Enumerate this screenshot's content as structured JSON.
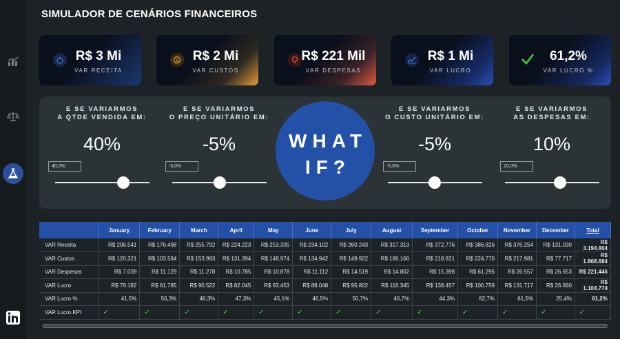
{
  "title": "SIMULADOR DE CENÁRIOS FINANCEIROS",
  "sidebar": {
    "icons": [
      "chart-icon",
      "scale-icon",
      "flask-icon",
      "linkedin-icon"
    ]
  },
  "kpis": [
    {
      "value": "R$ 3 Mi",
      "label": "VAR RECEITA",
      "icon": "money-bag-icon"
    },
    {
      "value": "R$ 2 Mi",
      "label": "VAR CUSTOS",
      "icon": "coin-icon"
    },
    {
      "value": "R$ 221 Mil",
      "label": "VAR DESPESAS",
      "icon": "expense-icon"
    },
    {
      "value": "R$ 1 Mi",
      "label": "VAR LUCRO",
      "icon": "profit-chart-icon"
    },
    {
      "value": "61,2%",
      "label": "VAR LUCRO %",
      "icon": "check-icon"
    }
  ],
  "scenarios": [
    {
      "q1": "E SE VARIARMOS",
      "q2": "A QTDE VENDIDA EM:",
      "value": "40%",
      "input": "40,0%",
      "level": 0.7
    },
    {
      "q1": "E SE VARIARMOS",
      "q2": "O PREÇO UNITÁRIO EM:",
      "value": "-5%",
      "input": "-5,0%",
      "level": 0.45
    },
    {
      "q1": "E SE VARIARMOS",
      "q2": "O CUSTO UNITÁRIO EM:",
      "value": "-5%",
      "input": "-5,0%",
      "level": 0.45
    },
    {
      "q1": "E SE VARIARMOS",
      "q2": "AS DESPESAS EM:",
      "value": "10%",
      "input": "10,0%",
      "level": 0.55
    }
  ],
  "whatif": {
    "line1": "WHAT",
    "line2": "IF?"
  },
  "table": {
    "headers": [
      "",
      "January",
      "February",
      "March",
      "April",
      "May",
      "June",
      "July",
      "August",
      "September",
      "October",
      "November",
      "December",
      "Total"
    ],
    "rows": [
      [
        "VAR Receita",
        "R$ 206.541",
        "R$ 176.498",
        "R$ 255.792",
        "R$ 224.223",
        "R$ 253.305",
        "R$ 234.102",
        "R$ 260.243",
        "R$ 317.313",
        "R$ 372.776",
        "R$ 386.826",
        "R$ 376.254",
        "R$ 131.030",
        "R$ 3.194.904"
      ],
      [
        "VAR Custos",
        "R$ 120.321",
        "R$ 103.584",
        "R$ 153.993",
        "R$ 131.394",
        "R$ 148.974",
        "R$ 134.942",
        "R$ 149.922",
        "R$ 186.166",
        "R$ 218.921",
        "R$ 224.770",
        "R$ 217.981",
        "R$ 77.717",
        "R$ 1.868.684"
      ],
      [
        "VAR Despesas",
        "R$ 7.039",
        "R$ 11.129",
        "R$ 11.278",
        "R$ 10.785",
        "R$ 10.878",
        "R$ 11.112",
        "R$ 14.519",
        "R$ 14.802",
        "R$ 15.398",
        "R$ 61.296",
        "R$ 26.557",
        "R$ 26.653",
        "R$ 221.446"
      ],
      [
        "VAR Lucro",
        "R$ 79.182",
        "R$ 61.785",
        "R$ 90.522",
        "R$ 82.045",
        "R$ 93.453",
        "R$ 88.048",
        "R$ 95.802",
        "R$ 116.345",
        "R$ 138.457",
        "R$ 100.759",
        "R$ 131.717",
        "R$ 26.660",
        "R$ 1.104.774"
      ],
      [
        "VAR Lucro %",
        "41,5%",
        "56,3%",
        "46,3%",
        "47,3%",
        "45,1%",
        "46,5%",
        "50,7%",
        "46,7%",
        "44,3%",
        "82,7%",
        "61,5%",
        "25,4%",
        "61,2%"
      ]
    ],
    "kpi_row_label": "VAR Lucro KPI",
    "check": "✓"
  }
}
